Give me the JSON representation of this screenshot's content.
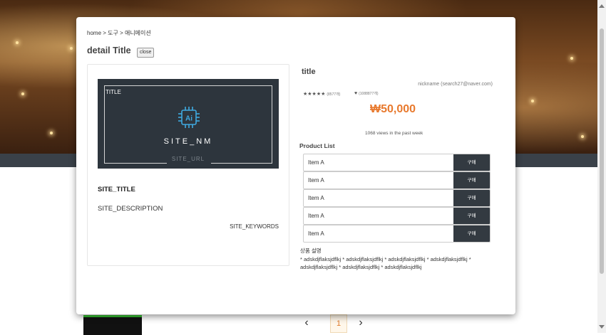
{
  "modal": {
    "breadcrumb": "home > 도구 > 애니메이션",
    "title": "detail Title",
    "close_label": "close"
  },
  "site_card": {
    "thumb_title": "TITLE",
    "site_nm": "SITE_NM",
    "site_url": "SITE_URL",
    "site_title": "SITE_TITLE",
    "site_description": "SITE_DESCRIPTION",
    "site_keywords": "SITE_KEYWORDS",
    "icon": "ai-chip-icon",
    "icon_color": "#3fa9e0"
  },
  "product": {
    "title": "title",
    "nickname": "nickname (search27@naver.com)",
    "rating_stars": "★★★★★",
    "rating_count": "(8577개)",
    "likes_icon": "♥",
    "likes_count": "(1088877개)",
    "price": "₩50,000",
    "price_color": "#e8792d",
    "views": "1068 views in the past week",
    "list_label": "Product List",
    "items": [
      {
        "name": "Item A",
        "buy_label": "구매"
      },
      {
        "name": "Item A",
        "buy_label": "구매"
      },
      {
        "name": "Item A",
        "buy_label": "구매"
      },
      {
        "name": "Item A",
        "buy_label": "구매"
      },
      {
        "name": "Item A",
        "buy_label": "구매"
      }
    ],
    "description_label": "상품 설명",
    "description_text": "* adskdjflaksjdflkj * adskdjflaksjdflkj * adskdjflaksjdflkj * adskdjflaksjdflkj * adskdjflaksjdflkj * adskdjflaksjdflkj * adskdjflaksjdflkj"
  },
  "pagination": {
    "prev": "‹",
    "current": "1",
    "next": "›"
  }
}
